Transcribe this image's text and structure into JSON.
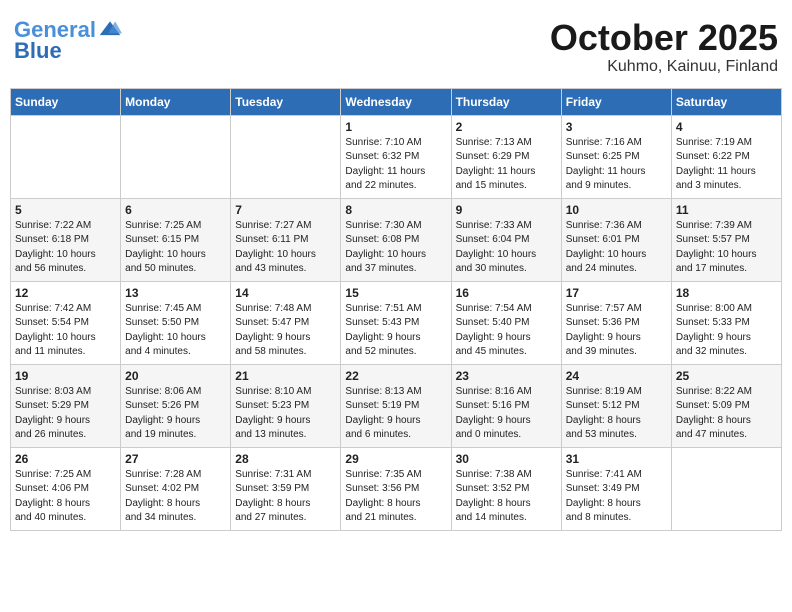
{
  "header": {
    "logo_general": "General",
    "logo_blue": "Blue",
    "month": "October 2025",
    "location": "Kuhmo, Kainuu, Finland"
  },
  "weekdays": [
    "Sunday",
    "Monday",
    "Tuesday",
    "Wednesday",
    "Thursday",
    "Friday",
    "Saturday"
  ],
  "weeks": [
    [
      {
        "day": "",
        "info": ""
      },
      {
        "day": "",
        "info": ""
      },
      {
        "day": "",
        "info": ""
      },
      {
        "day": "1",
        "info": "Sunrise: 7:10 AM\nSunset: 6:32 PM\nDaylight: 11 hours\nand 22 minutes."
      },
      {
        "day": "2",
        "info": "Sunrise: 7:13 AM\nSunset: 6:29 PM\nDaylight: 11 hours\nand 15 minutes."
      },
      {
        "day": "3",
        "info": "Sunrise: 7:16 AM\nSunset: 6:25 PM\nDaylight: 11 hours\nand 9 minutes."
      },
      {
        "day": "4",
        "info": "Sunrise: 7:19 AM\nSunset: 6:22 PM\nDaylight: 11 hours\nand 3 minutes."
      }
    ],
    [
      {
        "day": "5",
        "info": "Sunrise: 7:22 AM\nSunset: 6:18 PM\nDaylight: 10 hours\nand 56 minutes."
      },
      {
        "day": "6",
        "info": "Sunrise: 7:25 AM\nSunset: 6:15 PM\nDaylight: 10 hours\nand 50 minutes."
      },
      {
        "day": "7",
        "info": "Sunrise: 7:27 AM\nSunset: 6:11 PM\nDaylight: 10 hours\nand 43 minutes."
      },
      {
        "day": "8",
        "info": "Sunrise: 7:30 AM\nSunset: 6:08 PM\nDaylight: 10 hours\nand 37 minutes."
      },
      {
        "day": "9",
        "info": "Sunrise: 7:33 AM\nSunset: 6:04 PM\nDaylight: 10 hours\nand 30 minutes."
      },
      {
        "day": "10",
        "info": "Sunrise: 7:36 AM\nSunset: 6:01 PM\nDaylight: 10 hours\nand 24 minutes."
      },
      {
        "day": "11",
        "info": "Sunrise: 7:39 AM\nSunset: 5:57 PM\nDaylight: 10 hours\nand 17 minutes."
      }
    ],
    [
      {
        "day": "12",
        "info": "Sunrise: 7:42 AM\nSunset: 5:54 PM\nDaylight: 10 hours\nand 11 minutes."
      },
      {
        "day": "13",
        "info": "Sunrise: 7:45 AM\nSunset: 5:50 PM\nDaylight: 10 hours\nand 4 minutes."
      },
      {
        "day": "14",
        "info": "Sunrise: 7:48 AM\nSunset: 5:47 PM\nDaylight: 9 hours\nand 58 minutes."
      },
      {
        "day": "15",
        "info": "Sunrise: 7:51 AM\nSunset: 5:43 PM\nDaylight: 9 hours\nand 52 minutes."
      },
      {
        "day": "16",
        "info": "Sunrise: 7:54 AM\nSunset: 5:40 PM\nDaylight: 9 hours\nand 45 minutes."
      },
      {
        "day": "17",
        "info": "Sunrise: 7:57 AM\nSunset: 5:36 PM\nDaylight: 9 hours\nand 39 minutes."
      },
      {
        "day": "18",
        "info": "Sunrise: 8:00 AM\nSunset: 5:33 PM\nDaylight: 9 hours\nand 32 minutes."
      }
    ],
    [
      {
        "day": "19",
        "info": "Sunrise: 8:03 AM\nSunset: 5:29 PM\nDaylight: 9 hours\nand 26 minutes."
      },
      {
        "day": "20",
        "info": "Sunrise: 8:06 AM\nSunset: 5:26 PM\nDaylight: 9 hours\nand 19 minutes."
      },
      {
        "day": "21",
        "info": "Sunrise: 8:10 AM\nSunset: 5:23 PM\nDaylight: 9 hours\nand 13 minutes."
      },
      {
        "day": "22",
        "info": "Sunrise: 8:13 AM\nSunset: 5:19 PM\nDaylight: 9 hours\nand 6 minutes."
      },
      {
        "day": "23",
        "info": "Sunrise: 8:16 AM\nSunset: 5:16 PM\nDaylight: 9 hours\nand 0 minutes."
      },
      {
        "day": "24",
        "info": "Sunrise: 8:19 AM\nSunset: 5:12 PM\nDaylight: 8 hours\nand 53 minutes."
      },
      {
        "day": "25",
        "info": "Sunrise: 8:22 AM\nSunset: 5:09 PM\nDaylight: 8 hours\nand 47 minutes."
      }
    ],
    [
      {
        "day": "26",
        "info": "Sunrise: 7:25 AM\nSunset: 4:06 PM\nDaylight: 8 hours\nand 40 minutes."
      },
      {
        "day": "27",
        "info": "Sunrise: 7:28 AM\nSunset: 4:02 PM\nDaylight: 8 hours\nand 34 minutes."
      },
      {
        "day": "28",
        "info": "Sunrise: 7:31 AM\nSunset: 3:59 PM\nDaylight: 8 hours\nand 27 minutes."
      },
      {
        "day": "29",
        "info": "Sunrise: 7:35 AM\nSunset: 3:56 PM\nDaylight: 8 hours\nand 21 minutes."
      },
      {
        "day": "30",
        "info": "Sunrise: 7:38 AM\nSunset: 3:52 PM\nDaylight: 8 hours\nand 14 minutes."
      },
      {
        "day": "31",
        "info": "Sunrise: 7:41 AM\nSunset: 3:49 PM\nDaylight: 8 hours\nand 8 minutes."
      },
      {
        "day": "",
        "info": ""
      }
    ]
  ]
}
